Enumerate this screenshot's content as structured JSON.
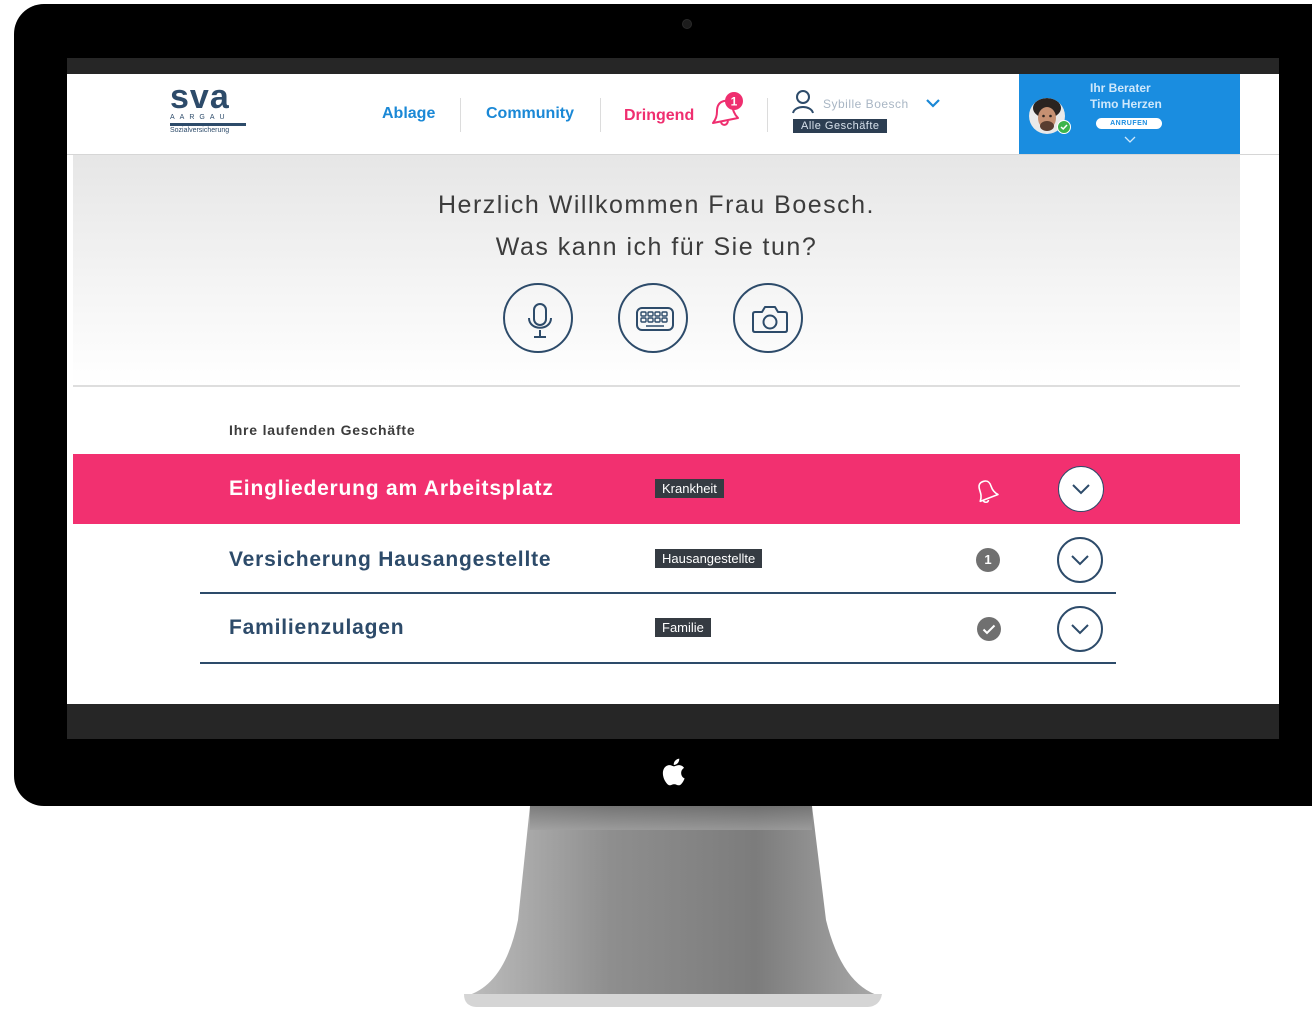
{
  "logo": {
    "text": "sva",
    "region": "AARGAU",
    "tagline": "Sozialversicherung"
  },
  "nav": {
    "ablage": "Ablage",
    "community": "Community",
    "dringend": "Dringend",
    "urgent_count": "1"
  },
  "user": {
    "name": "Sybille Boesch",
    "filter": "Alle Geschäfte"
  },
  "advisor": {
    "label": "Ihr Berater",
    "name": "Timo Herzen",
    "call": "ANRUFEN"
  },
  "hero": {
    "line1": "Herzlich Willkommen Frau Boesch.",
    "line2": "Was kann ich für Sie tun?"
  },
  "list": {
    "title": "Ihre laufenden Geschäfte",
    "items": [
      {
        "title": "Eingliederung am Arbeitsplatz",
        "tag": "Krankheit",
        "status": "bell-icon"
      },
      {
        "title": "Versicherung Hausangestellte",
        "tag": "Hausangestellte",
        "status": "1"
      },
      {
        "title": "Familienzulagen",
        "tag": "Familie",
        "status": "check-icon"
      }
    ]
  },
  "colors": {
    "brand_blue": "#1a88d6",
    "urgent_pink": "#f23070",
    "navy": "#2d4b6a"
  }
}
